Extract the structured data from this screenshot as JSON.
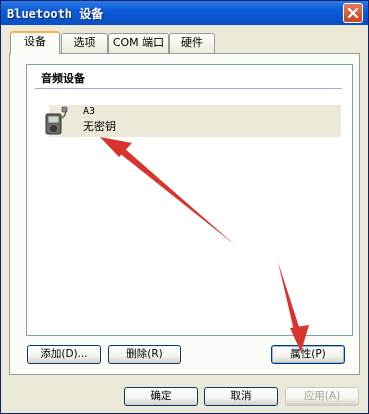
{
  "window": {
    "title": "Bluetooth 设备"
  },
  "tabs": [
    {
      "label": "设备"
    },
    {
      "label": "选项"
    },
    {
      "label": "COM 端口"
    },
    {
      "label": "硬件"
    }
  ],
  "device_group": {
    "header": "音频设备",
    "items": [
      {
        "name": "A3",
        "status": "无密钥",
        "icon": "headset-device-icon"
      }
    ]
  },
  "panel_buttons": {
    "add": "添加(D)...",
    "remove": "删除(R)",
    "properties": "属性(P)"
  },
  "dialog_buttons": {
    "ok": "确定",
    "cancel": "取消",
    "apply": "应用(A)"
  },
  "colors": {
    "titlebar": "#0b5bd8",
    "annotation_arrow": "#d9342b",
    "selected_item": "#ece9d8"
  }
}
